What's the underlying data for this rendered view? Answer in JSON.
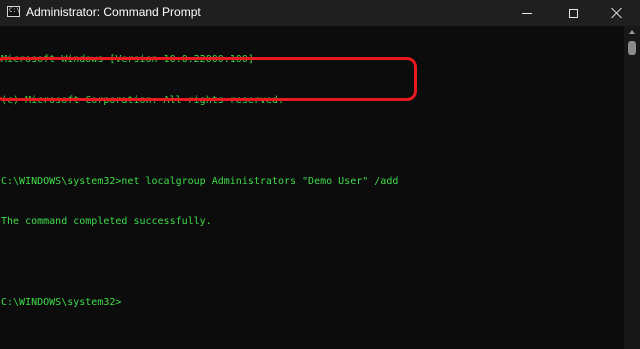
{
  "window": {
    "title": "Administrator: Command Prompt",
    "icon": "command-prompt-icon",
    "icon_glyph": "C:\\"
  },
  "controls": {
    "minimize_icon": "minimize-icon",
    "maximize_icon": "maximize-icon",
    "close_icon": "close-icon"
  },
  "console": {
    "text_color": "#3fdc4a",
    "background": "#0c0c0c",
    "lines": [
      "Microsoft Windows [Version 10.0.22000.100]",
      "(c) Microsoft Corporation. All rights reserved.",
      "",
      "C:\\WINDOWS\\system32>net localgroup Administrators \"Demo User\" /add",
      "The command completed successfully.",
      "",
      "C:\\WINDOWS\\system32>"
    ]
  },
  "highlight_color": "#e8191f"
}
